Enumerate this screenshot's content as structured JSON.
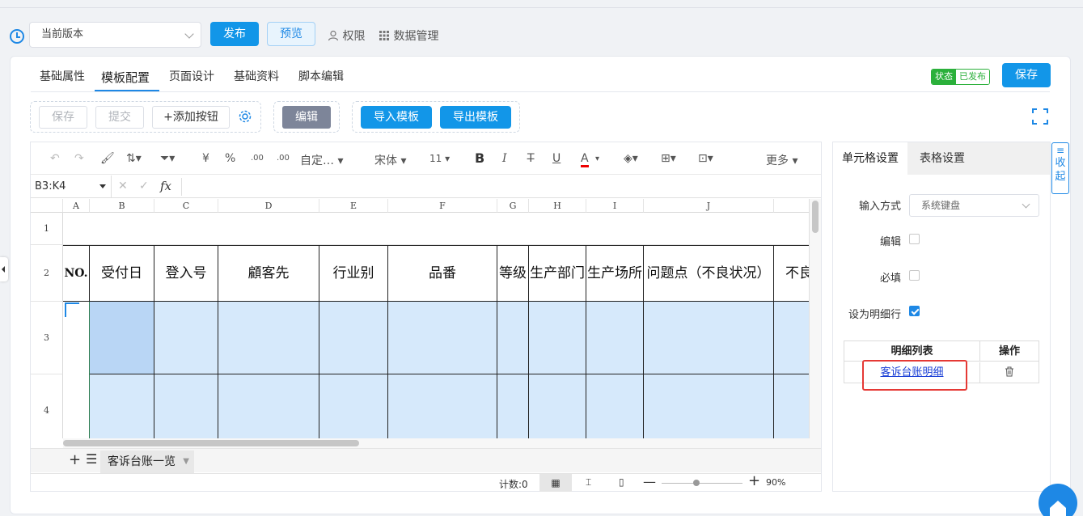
{
  "topbar": {
    "version_select": "当前版本",
    "publish_label": "发布",
    "preview_label": "预览",
    "permission_label": "权限",
    "data_manage_label": "数据管理"
  },
  "tabs": [
    {
      "label": "基础属性"
    },
    {
      "label": "模板配置"
    },
    {
      "label": "页面设计"
    },
    {
      "label": "基础资料"
    },
    {
      "label": "脚本编辑"
    }
  ],
  "status": {
    "key": "状态",
    "value": "已发布"
  },
  "save_label": "保存",
  "actions": {
    "save": "保存",
    "submit": "提交",
    "add_button": "+添加按钮",
    "edit": "编辑",
    "import_template": "导入模板",
    "export_template": "导出模板"
  },
  "toolbar": {
    "currency": "¥",
    "percent": "%",
    "custom_format": "自定…",
    "font_name": "宋体",
    "font_size": "11",
    "bold": "B",
    "italic": "I",
    "underline": "U",
    "font_color": "A",
    "more": "更多"
  },
  "formula": {
    "name_box": "B3:K4",
    "fx": "fx"
  },
  "columns": [
    "A",
    "B",
    "C",
    "D",
    "E",
    "F",
    "G",
    "H",
    "I",
    "J"
  ],
  "rows": [
    "1",
    "2",
    "3",
    "4"
  ],
  "header_cells": [
    "NO.",
    "受付日",
    "登入号",
    "顧客先",
    "行业别",
    "品番",
    "等级",
    "生产部门",
    "生产场所",
    "问题点（不良状况）",
    "不良"
  ],
  "sheet": {
    "tab_name": "客诉台账一览"
  },
  "statusbar": {
    "count": "计数:0",
    "zoom": "90%"
  },
  "right_panel": {
    "tab_cell": "单元格设置",
    "tab_table": "表格设置",
    "input_method_label": "输入方式",
    "input_method_value": "系统键盘",
    "edit_label": "编辑",
    "required_label": "必填",
    "detail_row_label": "设为明细行",
    "detail_list_header": "明细列表",
    "operation_header": "操作",
    "detail_item": "客诉台账明细",
    "collapse": "收起"
  },
  "colors": {
    "primary": "#1296e8",
    "selection": "#d6e9fb",
    "success": "#2bb03b",
    "highlight": "#e53935"
  }
}
